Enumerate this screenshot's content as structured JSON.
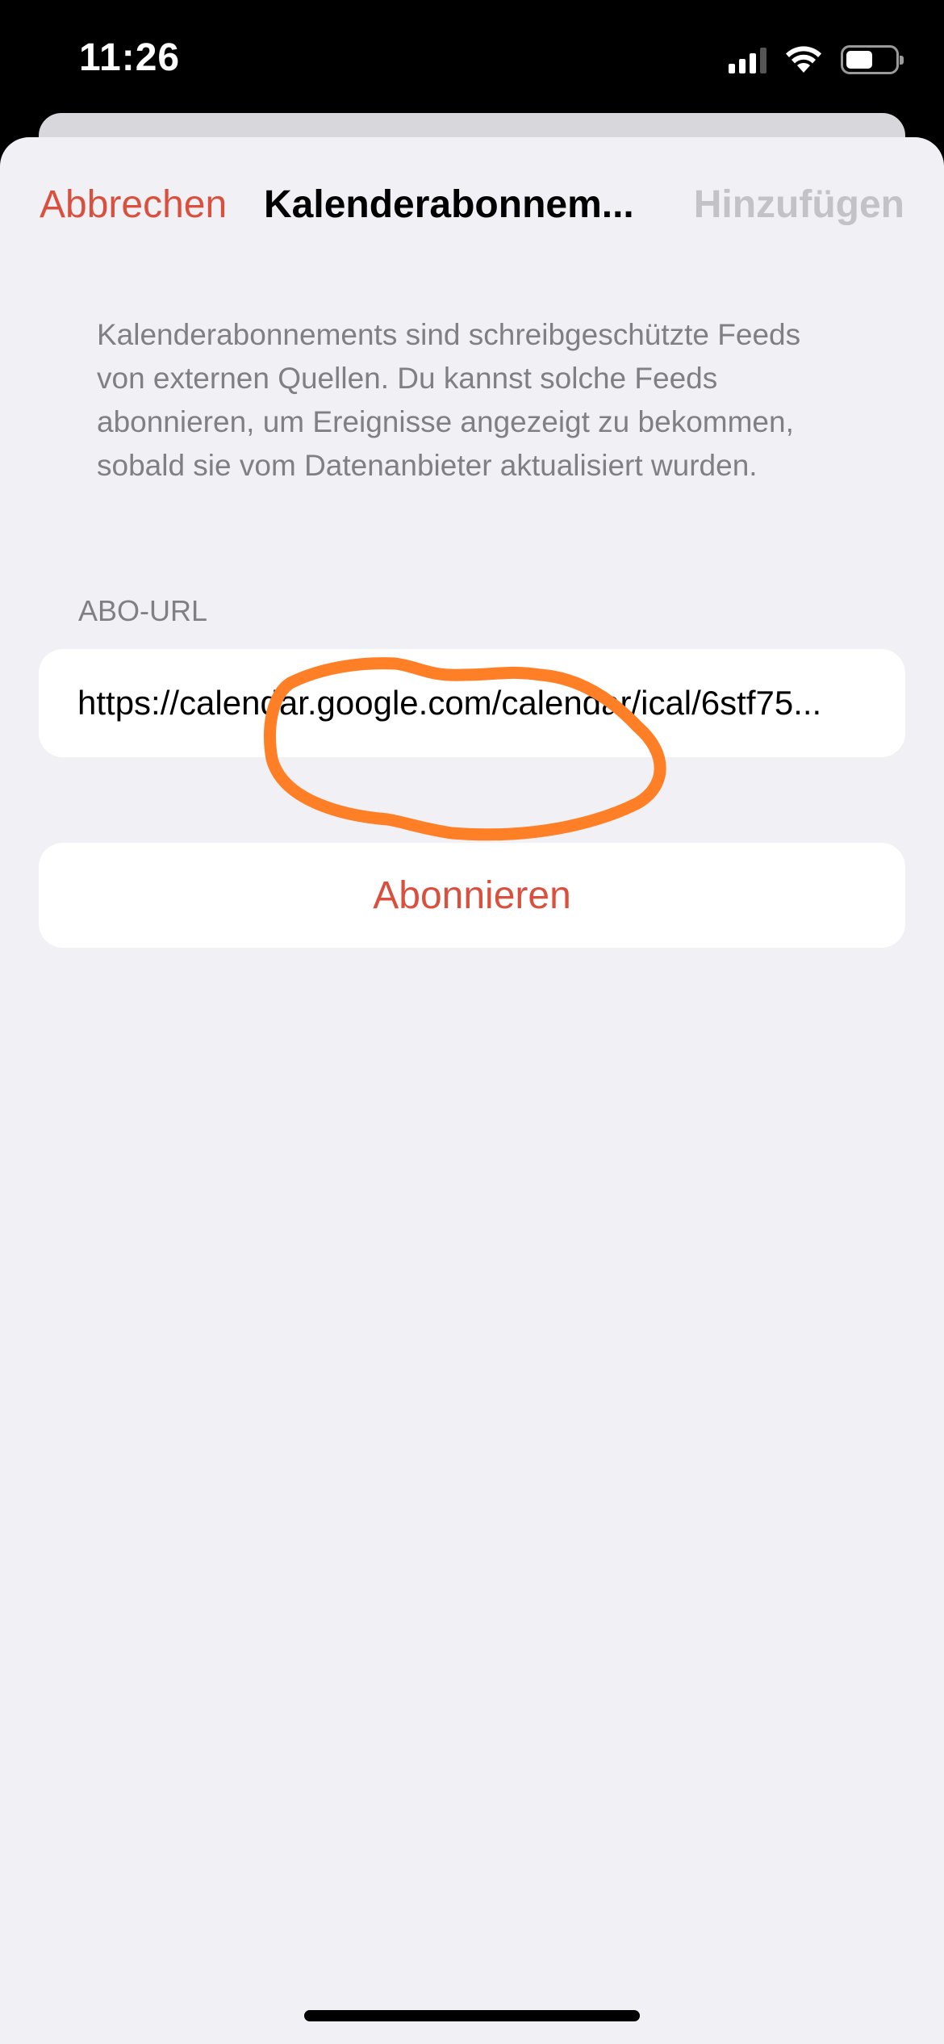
{
  "status_bar": {
    "time": "11:26"
  },
  "nav": {
    "cancel_label": "Abbrechen",
    "title": "Kalenderabonnem...",
    "add_label": "Hinzufügen"
  },
  "description": "Kalenderabonnements sind schreibgeschützte Feeds von externen Quellen. Du kannst solche Feeds abonnieren, um Ereignisse angezeigt zu bekommen, sobald sie vom Datenanbieter aktualisiert wurden.",
  "url_section": {
    "header": "ABO-URL",
    "value": "https://calendar.google.com/calendar/ical/6stf75..."
  },
  "subscribe_button": {
    "label": "Abonnieren"
  },
  "colors": {
    "accent": "#d9503f",
    "annotation": "#ff7f27",
    "disabled": "#c3c3c7",
    "secondary_text": "#7f7f84",
    "sheet_background": "#f1f1f5"
  }
}
